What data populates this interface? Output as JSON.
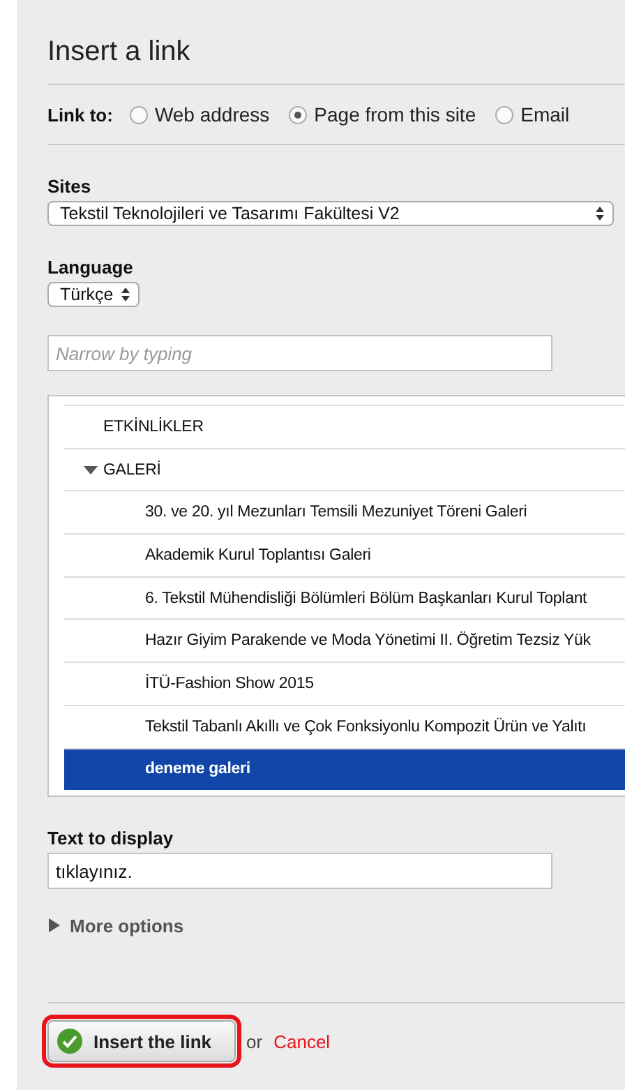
{
  "dialog": {
    "title": "Insert a link"
  },
  "link_to": {
    "label": "Link to:",
    "options": [
      {
        "label": "Web address",
        "selected": false
      },
      {
        "label": "Page from this site",
        "selected": true
      },
      {
        "label": "Email",
        "selected": false
      }
    ]
  },
  "sites": {
    "label": "Sites",
    "value": "Tekstil Teknolojileri ve Tasarımı Fakültesi V2"
  },
  "language": {
    "label": "Language",
    "value": "Türkçe"
  },
  "search": {
    "placeholder": "Narrow by typing"
  },
  "tree": [
    {
      "label": "ETKİNLİKLER",
      "selected": false
    },
    {
      "label": "GALERİ",
      "selected": false,
      "expanded": true,
      "children": [
        {
          "label": "30. ve 20. yıl Mezunları Temsili Mezuniyet Töreni Galeri",
          "selected": false
        },
        {
          "label": "Akademik Kurul Toplantısı Galeri",
          "selected": false
        },
        {
          "label": "6. Tekstil Mühendisliği Bölümleri Bölüm Başkanları Kurul Toplant",
          "selected": false
        },
        {
          "label": "Hazır Giyim Parakende ve Moda Yönetimi II. Öğretim Tezsiz Yük",
          "selected": false
        },
        {
          "label": "İTÜ-Fashion Show 2015",
          "selected": false
        },
        {
          "label": "Tekstil Tabanlı Akıllı ve Çok Fonksiyonlu Kompozit Ürün ve Yalıtı",
          "selected": false
        },
        {
          "label": "deneme galeri",
          "selected": true
        }
      ]
    }
  ],
  "text_to_display": {
    "label": "Text to display",
    "value": "tıklayınız."
  },
  "more_options": {
    "label": "More options",
    "expanded": false
  },
  "footer": {
    "insert_button": {
      "label": "Insert the link",
      "highlighted": true
    },
    "or": "or",
    "cancel": "Cancel"
  }
}
